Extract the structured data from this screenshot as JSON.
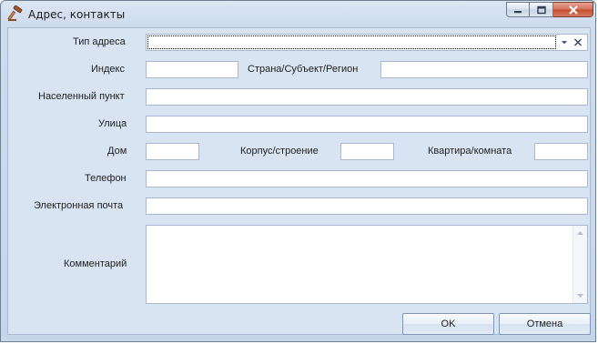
{
  "window": {
    "title": "Адрес, контакты",
    "icon": "gavel-icon"
  },
  "form": {
    "address_type": {
      "label": "Тип адреса",
      "value": ""
    },
    "index": {
      "label": "Индекс",
      "value": ""
    },
    "country_region": {
      "label": "Страна/Субъект/Регион",
      "value": ""
    },
    "locality": {
      "label": "Населенный пункт",
      "value": ""
    },
    "street": {
      "label": "Улица",
      "value": ""
    },
    "house": {
      "label": "Дом",
      "value": ""
    },
    "building": {
      "label": "Корпус/строение",
      "value": ""
    },
    "apartment": {
      "label": "Квартира/комната",
      "value": ""
    },
    "phone": {
      "label": "Телефон",
      "value": ""
    },
    "email": {
      "label": "Электронная почта",
      "value": ""
    },
    "comment": {
      "label": "Комментарий",
      "value": ""
    }
  },
  "buttons": {
    "ok": "OK",
    "cancel": "Отмена"
  },
  "colors": {
    "window_bg": "#d9e4f2",
    "field_border": "#a7b8cf",
    "close_button": "#c44c2f"
  }
}
